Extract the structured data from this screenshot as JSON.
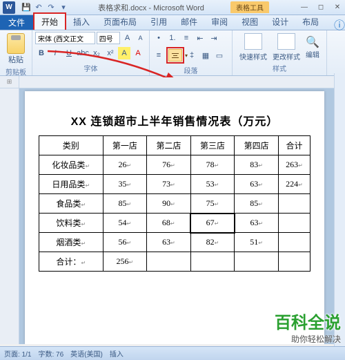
{
  "title_bar": {
    "doc_name": "表格求和.docx - Microsoft Word",
    "context_tab": "表格工具",
    "qat": [
      "save-icon",
      "undo-icon",
      "redo-icon"
    ]
  },
  "tabs": {
    "file": "文件",
    "items": [
      "开始",
      "插入",
      "页面布局",
      "引用",
      "邮件",
      "审阅",
      "视图",
      "设计",
      "布局"
    ],
    "active_index": 0
  },
  "ribbon": {
    "clipboard": {
      "label": "剪贴板",
      "paste": "粘贴"
    },
    "font": {
      "label": "字体",
      "name": "宋体 (西文正文",
      "size": "四号"
    },
    "paragraph": {
      "label": "段落"
    },
    "styles": {
      "label": "样式",
      "quick": "快速样式",
      "change": "更改样式",
      "edit": "编辑"
    }
  },
  "document": {
    "title": "XX 连锁超市上半年销售情况表（万元）",
    "headers": [
      "类别",
      "第一店",
      "第二店",
      "第三店",
      "第四店",
      "合计"
    ],
    "rows": [
      {
        "label": "化妆品类",
        "c1": "26",
        "c2": "76",
        "c3": "78",
        "c4": "83",
        "sum": "263"
      },
      {
        "label": "日用品类",
        "c1": "35",
        "c2": "73",
        "c3": "53",
        "c4": "63",
        "sum": "224"
      },
      {
        "label": "食品类",
        "c1": "85",
        "c2": "90",
        "c3": "75",
        "c4": "85",
        "sum": ""
      },
      {
        "label": "饮料类",
        "c1": "54",
        "c2": "68",
        "c3": "67",
        "c4": "63",
        "sum": ""
      },
      {
        "label": "烟酒类",
        "c1": "56",
        "c2": "63",
        "c3": "82",
        "c4": "51",
        "sum": ""
      },
      {
        "label": "合计：",
        "c1": "256",
        "c2": "",
        "c3": "",
        "c4": "",
        "sum": ""
      }
    ],
    "selected_cell": {
      "row": 3,
      "col": 3
    }
  },
  "status": {
    "page": "页面: 1/1",
    "words": "字数: 76",
    "lang": "英语(美国)",
    "insert": "插入"
  },
  "watermark": {
    "big": "百科全说",
    "small": "助你轻松解决"
  }
}
